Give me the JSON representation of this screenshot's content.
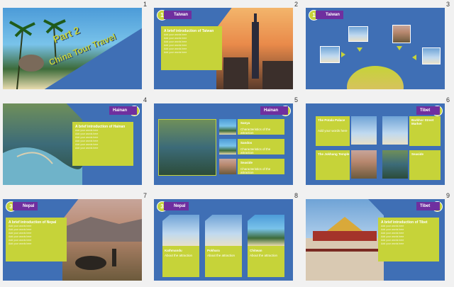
{
  "slides": [
    {
      "num": "1",
      "title_line1": "Part 2",
      "title_line2": "China Tour Travel"
    },
    {
      "num": "2",
      "badge": "1",
      "tag": "Taiwan",
      "box_title": "A brief introduction of Taiwan",
      "lines": [
        "Add your words here",
        "Add your words here",
        "Add your words here",
        "Add your words here",
        "Add your words here",
        "Add your words here"
      ]
    },
    {
      "num": "3",
      "badge": "1",
      "tag": "Taiwan"
    },
    {
      "num": "4",
      "badge": "2",
      "tag": "Hainan",
      "box_title": "A brief introduction of Hainan",
      "lines": [
        "Add your words here",
        "Add your words here",
        "Add your words here",
        "Add your words here",
        "Add your words here",
        "Add your words here"
      ]
    },
    {
      "num": "5",
      "badge": "2",
      "tag": "Hainan",
      "items": [
        {
          "title": "Sanya",
          "desc": "Characteristics of the attraction"
        },
        {
          "title": "Sandos",
          "desc": "Characteristics of the attraction"
        },
        {
          "title": "Seaside",
          "desc": "Characteristics of the attraction"
        }
      ]
    },
    {
      "num": "6",
      "badge": "4",
      "tag": "Tibet",
      "boxes": [
        {
          "title": "The Potala Palace"
        },
        {
          "title": "Barkhor Street Market"
        },
        {
          "title": "The Jokhang Temple"
        },
        {
          "title": "Seaside"
        }
      ],
      "line": "Add your words here"
    },
    {
      "num": "7",
      "badge": "3",
      "tag": "Nepal",
      "box_title": "A brief introduction of Nepal",
      "lines": [
        "Add your words here",
        "Add your words here",
        "Add your words here",
        "Add your words here",
        "Add your words here",
        "Add your words here"
      ]
    },
    {
      "num": "8",
      "badge": "3",
      "tag": "Nepal",
      "items": [
        {
          "title": "Kathmandu",
          "desc": "About the attraction"
        },
        {
          "title": "Pokhara",
          "desc": "About the attraction"
        },
        {
          "title": "Chitwan",
          "desc": "About the attraction"
        }
      ]
    },
    {
      "num": "9",
      "badge": "4",
      "tag": "Tibet",
      "box_title": "A brief introduction of Tibet",
      "lines": [
        "Add your words here",
        "Add your words here",
        "Add your words here",
        "Add your words here",
        "Add your words here",
        "Add your words here"
      ]
    }
  ]
}
